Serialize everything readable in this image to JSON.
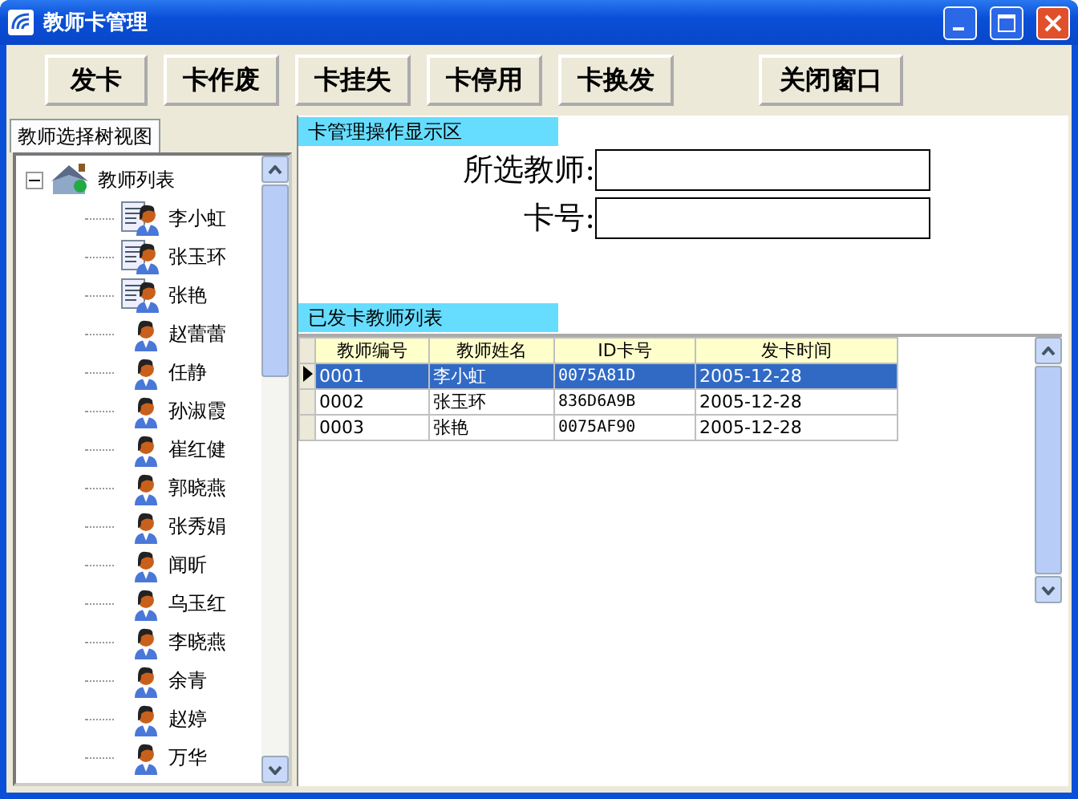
{
  "window": {
    "title": "教师卡管理"
  },
  "toolbar": [
    "发卡",
    "卡作废",
    "卡挂失",
    "卡停用",
    "卡换发",
    "关闭窗口"
  ],
  "left_tab": {
    "label": "教师选择树视图",
    "selected": true
  },
  "tree": {
    "label": "教师列表",
    "expanded": true,
    "children": [
      {
        "label": "李小虹",
        "kind": "card"
      },
      {
        "label": "张玉环",
        "kind": "card"
      },
      {
        "label": "张艳",
        "kind": "card"
      },
      {
        "label": "赵蕾蕾",
        "kind": "person"
      },
      {
        "label": "任静",
        "kind": "person"
      },
      {
        "label": "孙淑霞",
        "kind": "person"
      },
      {
        "label": "崔红健",
        "kind": "person"
      },
      {
        "label": "郭晓燕",
        "kind": "person"
      },
      {
        "label": "张秀娟",
        "kind": "person"
      },
      {
        "label": "闻昕",
        "kind": "person"
      },
      {
        "label": "乌玉红",
        "kind": "person"
      },
      {
        "label": "李晓燕",
        "kind": "person"
      },
      {
        "label": "余青",
        "kind": "person"
      },
      {
        "label": "赵婷",
        "kind": "person"
      },
      {
        "label": "万华",
        "kind": "person"
      }
    ]
  },
  "operation_section": {
    "title": "卡管理操作显示区",
    "fields": [
      {
        "label": "所选教师:"
      },
      {
        "label": "卡号:"
      }
    ]
  },
  "issued_section": {
    "title": "已发卡教师列表",
    "columns": [
      "教师编号",
      "教师姓名",
      "ID卡号",
      "发卡时间"
    ],
    "rows": [
      {
        "cells": [
          "0001",
          "李小虹",
          "0075A81D",
          "2005-12-28"
        ],
        "selected": true
      },
      {
        "cells": [
          "0002",
          "张玉环",
          "836D6A9B",
          "2005-12-28"
        ],
        "selected": false
      },
      {
        "cells": [
          "0003",
          "张艳",
          "0075AF90",
          "2005-12-28"
        ],
        "selected": false
      }
    ]
  }
}
